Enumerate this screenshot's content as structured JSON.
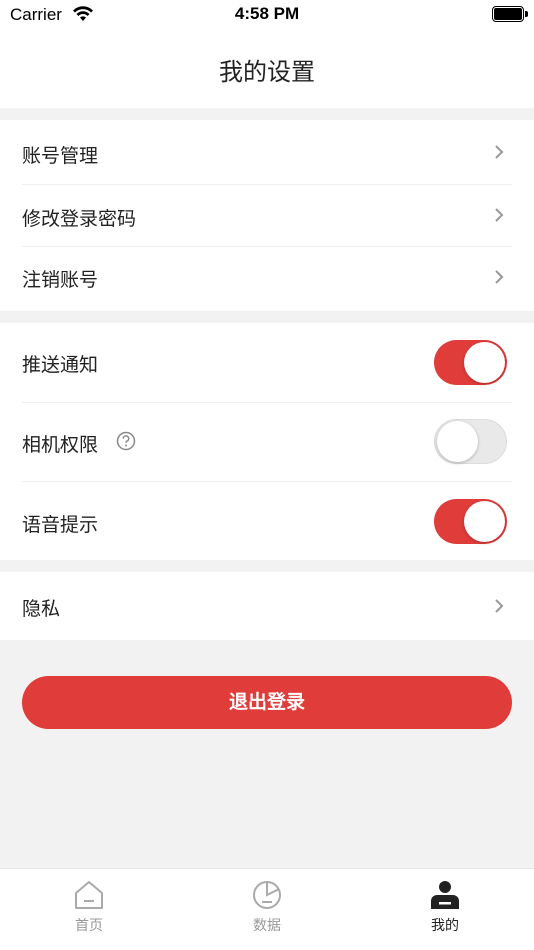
{
  "status_bar": {
    "carrier": "Carrier",
    "time": "4:58 PM"
  },
  "header": {
    "title": "我的设置"
  },
  "account_section": {
    "items": [
      {
        "label": "账号管理",
        "icon": "chevron-right-icon"
      },
      {
        "label": "修改登录密码",
        "icon": "chevron-right-icon"
      },
      {
        "label": "注销账号",
        "icon": "chevron-right-icon"
      }
    ]
  },
  "permissions_section": {
    "items": [
      {
        "label": "推送通知",
        "enabled": true
      },
      {
        "label": "相机权限",
        "enabled": false,
        "help_icon": "question-circle-icon"
      },
      {
        "label": "语音提示",
        "enabled": true
      }
    ]
  },
  "privacy_section": {
    "items": [
      {
        "label": "隐私",
        "icon": "chevron-right-icon"
      }
    ]
  },
  "logout": {
    "label": "退出登录"
  },
  "tab_bar": {
    "tabs": [
      {
        "label": "首页",
        "icon": "home-icon",
        "active": false
      },
      {
        "label": "数据",
        "icon": "pie-chart-icon",
        "active": false
      },
      {
        "label": "我的",
        "icon": "user-icon",
        "active": true
      }
    ]
  },
  "colors": {
    "accent": "#e03c39",
    "background": "#f2f2f2",
    "tab_inactive": "#999999",
    "tab_active": "#222222"
  }
}
